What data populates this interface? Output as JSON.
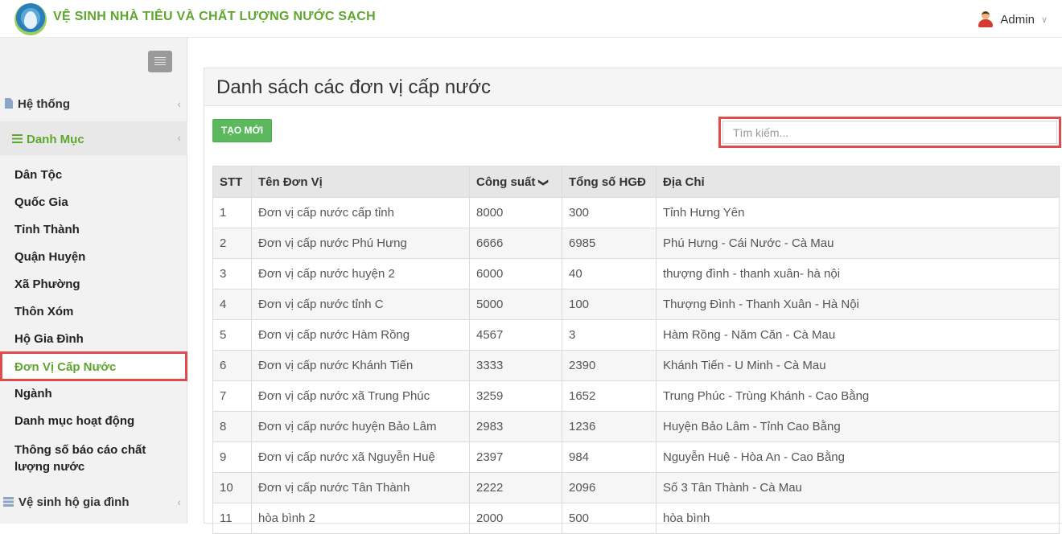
{
  "header": {
    "app_title": "VỆ SINH NHÀ TIÊU VÀ CHẤT LƯỢNG NƯỚC SẠCH",
    "user_name": "Admin"
  },
  "sidebar": {
    "groups": [
      {
        "label": "Hệ thống",
        "icon": "document-icon"
      },
      {
        "label": "Danh Mục",
        "icon": "list-icon"
      },
      {
        "label": "Vệ sinh hộ gia đình",
        "icon": "tasks-icon"
      }
    ],
    "items": [
      {
        "label": "Dân Tộc"
      },
      {
        "label": "Quốc Gia"
      },
      {
        "label": "Tỉnh Thành"
      },
      {
        "label": "Quận Huyện"
      },
      {
        "label": "Xã Phường"
      },
      {
        "label": "Thôn Xóm"
      },
      {
        "label": "Hộ Gia Đình"
      },
      {
        "label": "Đơn Vị Cấp Nước",
        "active": true
      },
      {
        "label": "Ngành"
      },
      {
        "label": "Danh mục hoạt động"
      },
      {
        "label_line1": "Thông số báo cáo chất",
        "label_line2": "lượng nước"
      }
    ]
  },
  "main": {
    "title": "Danh sách các đơn vị cấp nước",
    "new_button": "TẠO MỚI",
    "search_placeholder": "Tìm kiếm...",
    "table": {
      "columns": [
        "STT",
        "Tên Đơn Vị",
        "Công suất",
        "Tổng số HGĐ",
        "Địa Chỉ"
      ],
      "sorted_column": "Công suất",
      "sort_direction": "descending",
      "rows": [
        [
          "1",
          "Đơn vị cấp nước cấp tỉnh",
          "8000",
          "300",
          "Tỉnh Hưng Yên"
        ],
        [
          "2",
          "Đơn vị cấp nước Phú Hưng",
          "6666",
          "6985",
          "Phú Hưng - Cái Nước - Cà Mau"
        ],
        [
          "3",
          "Đơn vị cấp nước huyện 2",
          "6000",
          "40",
          "thượng đình - thanh xuân- hà nội"
        ],
        [
          "4",
          "Đơn vị cấp nước tỉnh C",
          "5000",
          "100",
          "Thượng Đình - Thanh Xuân - Hà Nội"
        ],
        [
          "5",
          "Đơn vị cấp nước Hàm Rồng",
          "4567",
          "3",
          "Hàm Rồng - Năm Căn - Cà Mau"
        ],
        [
          "6",
          "Đơn vị cấp nước Khánh Tiến",
          "3333",
          "2390",
          "Khánh Tiến - U Minh - Cà Mau"
        ],
        [
          "7",
          "Đơn vị cấp nước xã Trung Phúc",
          "3259",
          "1652",
          "Trung Phúc - Trùng Khánh - Cao Bằng"
        ],
        [
          "8",
          "Đơn vị cấp nước huyện Bảo Lâm",
          "2983",
          "1236",
          "Huyện Bảo Lâm - Tỉnh Cao Bằng"
        ],
        [
          "9",
          "Đơn vị cấp nước xã Nguyễn Huệ",
          "2397",
          "984",
          "Nguyễn Huệ - Hòa An - Cao Bằng"
        ],
        [
          "10",
          "Đơn vị cấp nước Tân Thành",
          "2222",
          "2096",
          "Số 3 Tân Thành - Cà Mau"
        ],
        [
          "11",
          "hòa bình 2",
          "2000",
          "500",
          "hòa bình"
        ]
      ]
    }
  },
  "colors": {
    "brand_green": "#5fa62e",
    "button_green": "#5cb85c",
    "highlight_red": "#e04b4b"
  }
}
